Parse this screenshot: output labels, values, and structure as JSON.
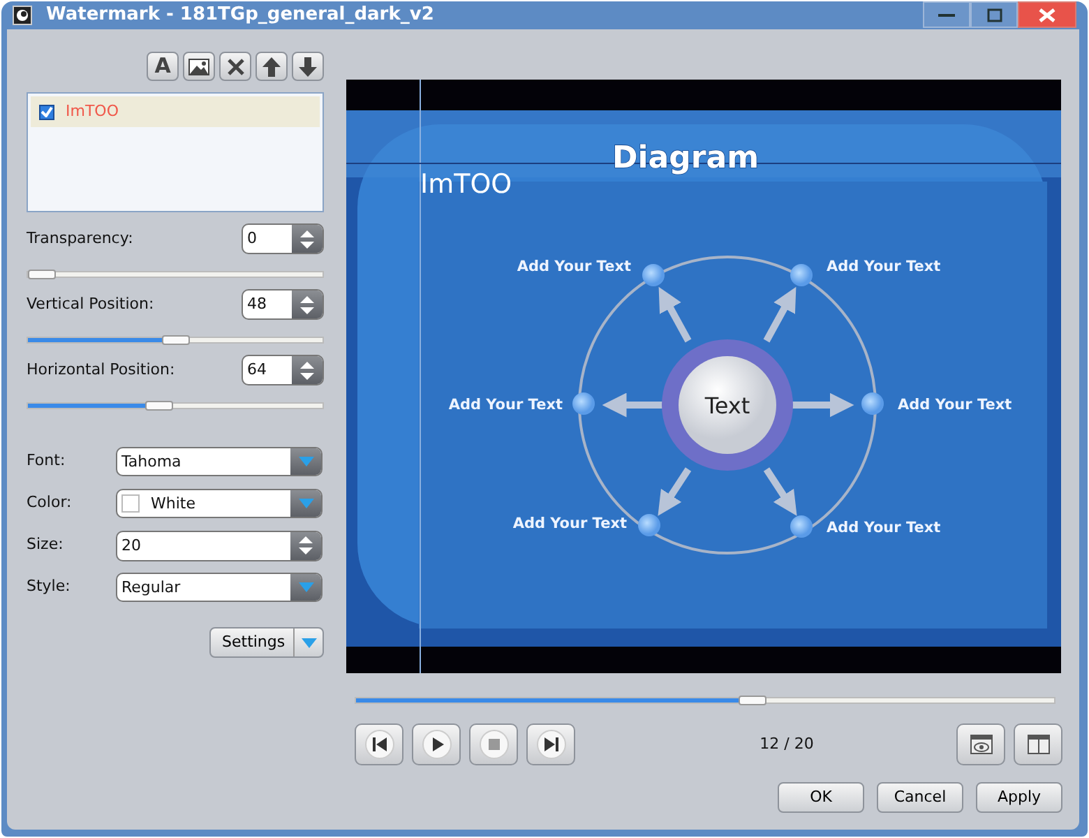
{
  "window": {
    "title": "Watermark - 181TGp_general_dark_v2"
  },
  "toolbar": [
    {
      "kind": "text",
      "label": "A"
    },
    {
      "kind": "image"
    },
    {
      "kind": "delete"
    },
    {
      "kind": "up"
    },
    {
      "kind": "down"
    }
  ],
  "watermark_list": [
    {
      "label": "ImTOO",
      "checked": true,
      "selected": true
    }
  ],
  "sliders": [
    {
      "label": "Transparency:",
      "value": "0",
      "level": 0.0
    },
    {
      "label": "Vertical Position:",
      "value": "48",
      "level": 0.48
    },
    {
      "label": "Horizontal Position:",
      "value": "64",
      "level": 0.42
    }
  ],
  "fields": [
    {
      "label": "Font:",
      "value": "Tahoma",
      "kind": "dropdown"
    },
    {
      "label": "Color:",
      "value": "White",
      "kind": "color",
      "color": "#ffffff"
    },
    {
      "label": "Size:",
      "value": "20",
      "kind": "spin"
    },
    {
      "label": "Style:",
      "value": "Regular",
      "kind": "dropdown"
    }
  ],
  "settings_button": "Settings",
  "preview": {
    "title": "Diagram",
    "watermark_text": "ImTOO",
    "center_label": "Text",
    "node_labels": [
      "Add Your Text",
      "Add Your Text",
      "Add Your Text",
      "Add Your Text",
      "Add Your Text",
      "Add Your Text"
    ]
  },
  "playback": {
    "level": 0.57,
    "counter": "12 / 20",
    "controls": [
      {
        "kind": "first"
      },
      {
        "kind": "play"
      },
      {
        "kind": "stop"
      },
      {
        "kind": "last"
      }
    ]
  },
  "buttons": [
    "OK",
    "Cancel",
    "Apply"
  ]
}
